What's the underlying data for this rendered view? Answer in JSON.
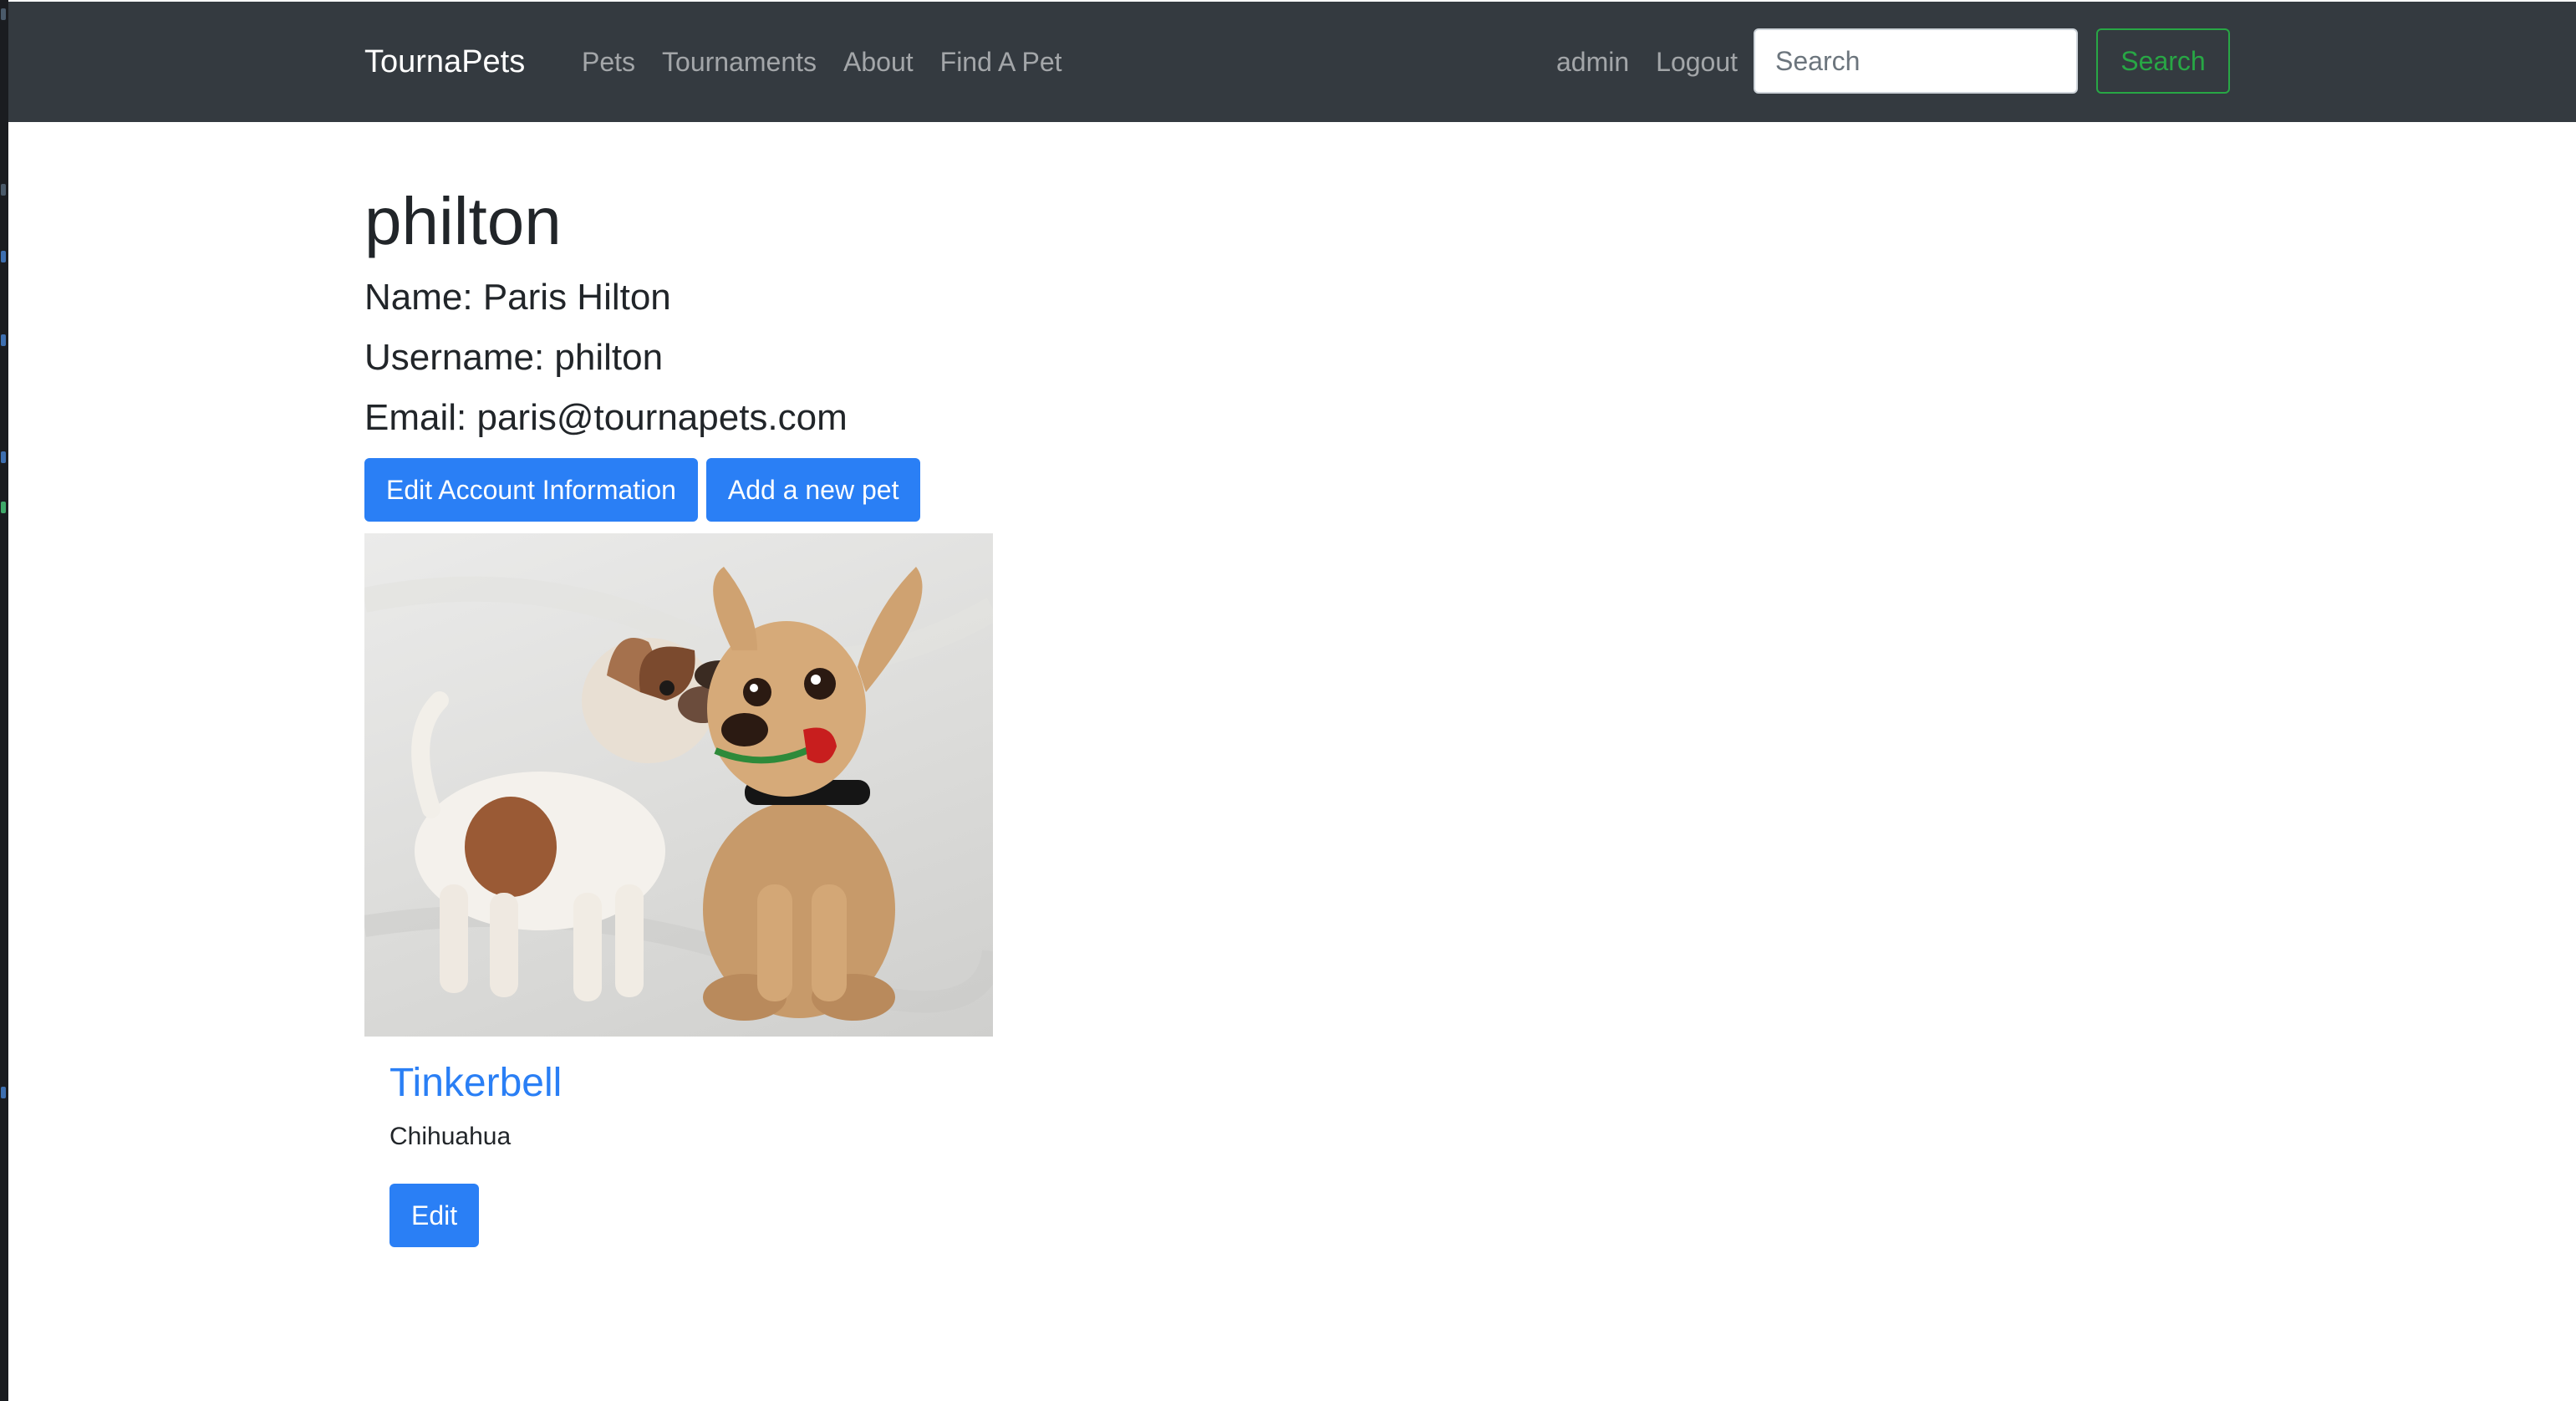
{
  "navbar": {
    "brand": "TournaPets",
    "links": [
      "Pets",
      "Tournaments",
      "About",
      "Find A Pet"
    ],
    "user_links": [
      "admin",
      "Logout"
    ],
    "search_placeholder": "Search",
    "search_button": "Search"
  },
  "profile": {
    "title": "philton",
    "name_line": "Name: Paris Hilton",
    "username_line": "Username: philton",
    "email_line": "Email: paris@tournapets.com",
    "edit_account_button": "Edit Account Information",
    "add_pet_button": "Add a new pet"
  },
  "pets": [
    {
      "name": "Tinkerbell",
      "breed": "Chihuahua",
      "edit_button": "Edit"
    }
  ],
  "colors": {
    "navbar_bg": "#343a40",
    "primary": "#2a7ff5",
    "success": "#28a745"
  }
}
